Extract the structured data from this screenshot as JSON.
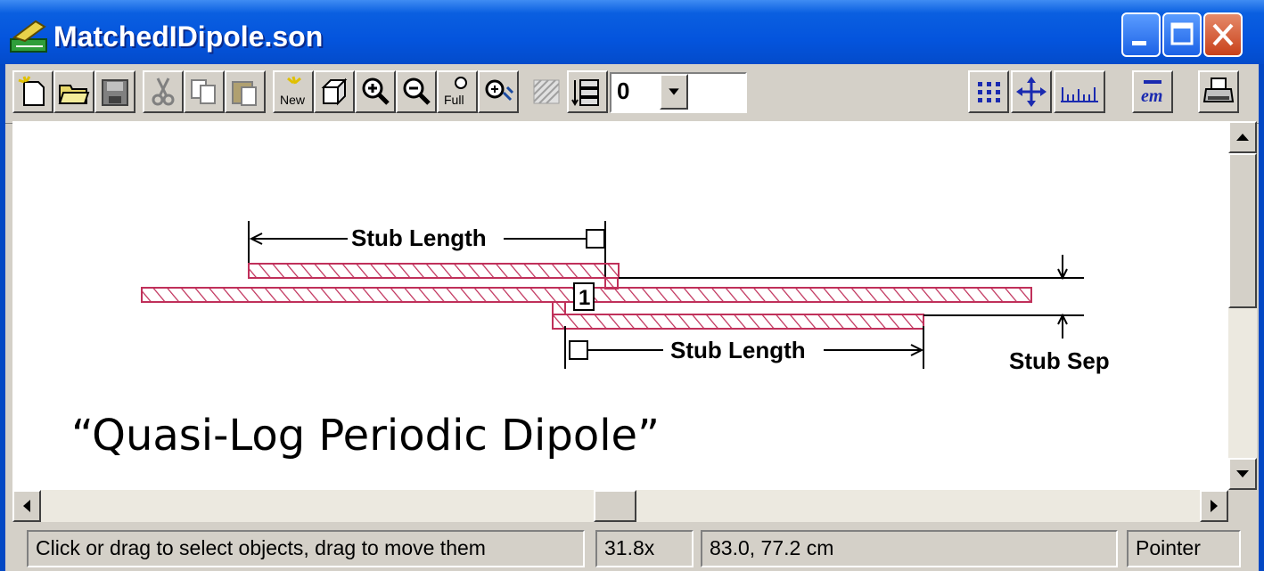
{
  "window": {
    "title": "MatchedIDipole.son"
  },
  "toolbar": {
    "buttons": [
      {
        "icon": "new-file-icon"
      },
      {
        "icon": "open-folder-icon"
      },
      {
        "icon": "save-disk-icon"
      },
      {
        "icon": "cut-icon"
      },
      {
        "icon": "copy-icon"
      },
      {
        "icon": "paste-icon"
      },
      {
        "icon": "new-view-icon"
      },
      {
        "icon": "3d-view-icon"
      },
      {
        "icon": "zoom-in-icon"
      },
      {
        "icon": "zoom-out-icon"
      },
      {
        "icon": "zoom-full-icon"
      },
      {
        "icon": "zoom-area-icon"
      },
      {
        "icon": "layer-hatch-icon"
      },
      {
        "icon": "layers-icon"
      },
      {
        "icon": "grid-icon"
      },
      {
        "icon": "move-icon"
      },
      {
        "icon": "ruler-icon"
      },
      {
        "icon": "em-icon"
      },
      {
        "icon": "print-icon"
      }
    ],
    "new_label": "New",
    "full_label": "Full",
    "em_label": "em",
    "layer_select_value": "0"
  },
  "drawing": {
    "top_dimension_label": "Stub Length",
    "bottom_dimension_label": "Stub Length",
    "separation_label": "Stub Sep",
    "port_label": "1",
    "caption": "“Quasi-Log Periodic Dipole”",
    "metal_color": "#c0305a"
  },
  "statusbar": {
    "message": "Click or drag to select objects, drag to move them",
    "zoom": "31.8x",
    "coordinates": "83.0, 77.2 cm",
    "mode": "Pointer"
  }
}
